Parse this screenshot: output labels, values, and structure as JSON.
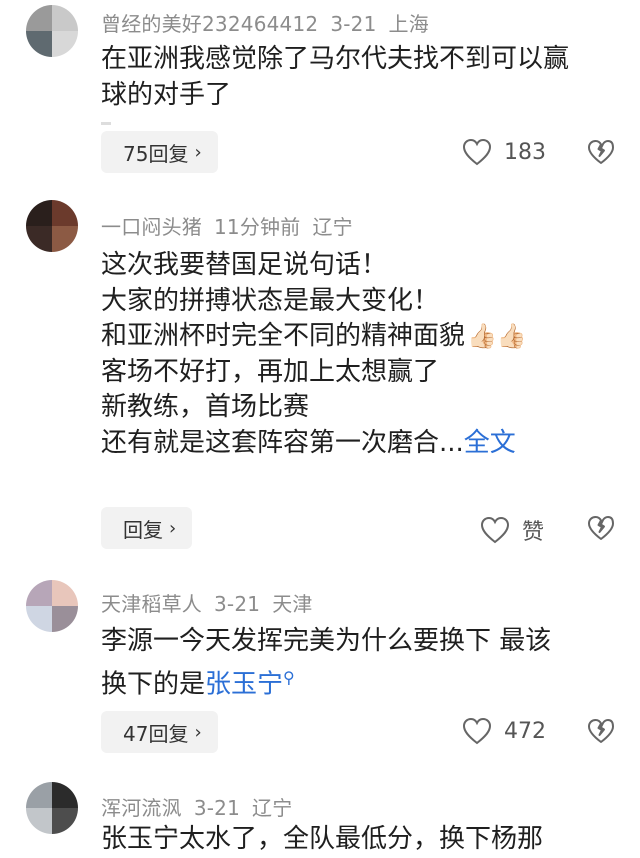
{
  "comments": [
    {
      "author": "曾经的美好232464412",
      "date": "3-21",
      "location": "上海",
      "lines": [
        "在亚洲我感觉除了马尔代夫找不到可以赢",
        "球的对手了"
      ],
      "reply_label": "75回复",
      "likes": "183",
      "avatar_colors": [
        "#9a9a9a",
        "#c9c9c9",
        "#5f6a70",
        "#d8d8d8"
      ]
    },
    {
      "author": "一口闷头猪",
      "date": "11分钟前",
      "location": "辽宁",
      "lines": [
        "这次我要替国足说句话！",
        "大家的拼搏状态是最大变化！",
        "和亚洲杯时完全不同的精神面貌",
        "客场不好打，再加上太想赢了",
        "新教练，首场比赛",
        "还有就是这套阵容第一次磨合..."
      ],
      "thumbs": "👍🏻👍🏻",
      "more_link": "全文",
      "reply_label": "回复",
      "likes": "赞",
      "avatar_colors": [
        "#2a1f1c",
        "#6b3a2c",
        "#3b2a26",
        "#8c5a44"
      ]
    },
    {
      "author": "天津稻草人",
      "date": "3-21",
      "location": "天津",
      "lines": [
        "李源一今天发挥完美为什么要换下 最该",
        "换下的是"
      ],
      "mention_link": "张玉宁",
      "search_mark": "⚲",
      "reply_label": "47回复",
      "likes": "472",
      "avatar_colors": [
        "#b7a6b8",
        "#e8c6bb",
        "#cfd6e3",
        "#9a8f99"
      ]
    },
    {
      "author": "浑河流沨",
      "date": "3-21",
      "location": "辽宁",
      "lines": [
        "张玉宁太水了，全队最低分，换下杨那"
      ],
      "avatar_colors": [
        "#9aa0a6",
        "#2b2b2b",
        "#c2c6ca",
        "#4d4d4d"
      ]
    }
  ],
  "icons": {
    "like": "heart-outline-icon",
    "dislike": "broken-heart-icon",
    "chevron": "chevron-right-icon"
  }
}
